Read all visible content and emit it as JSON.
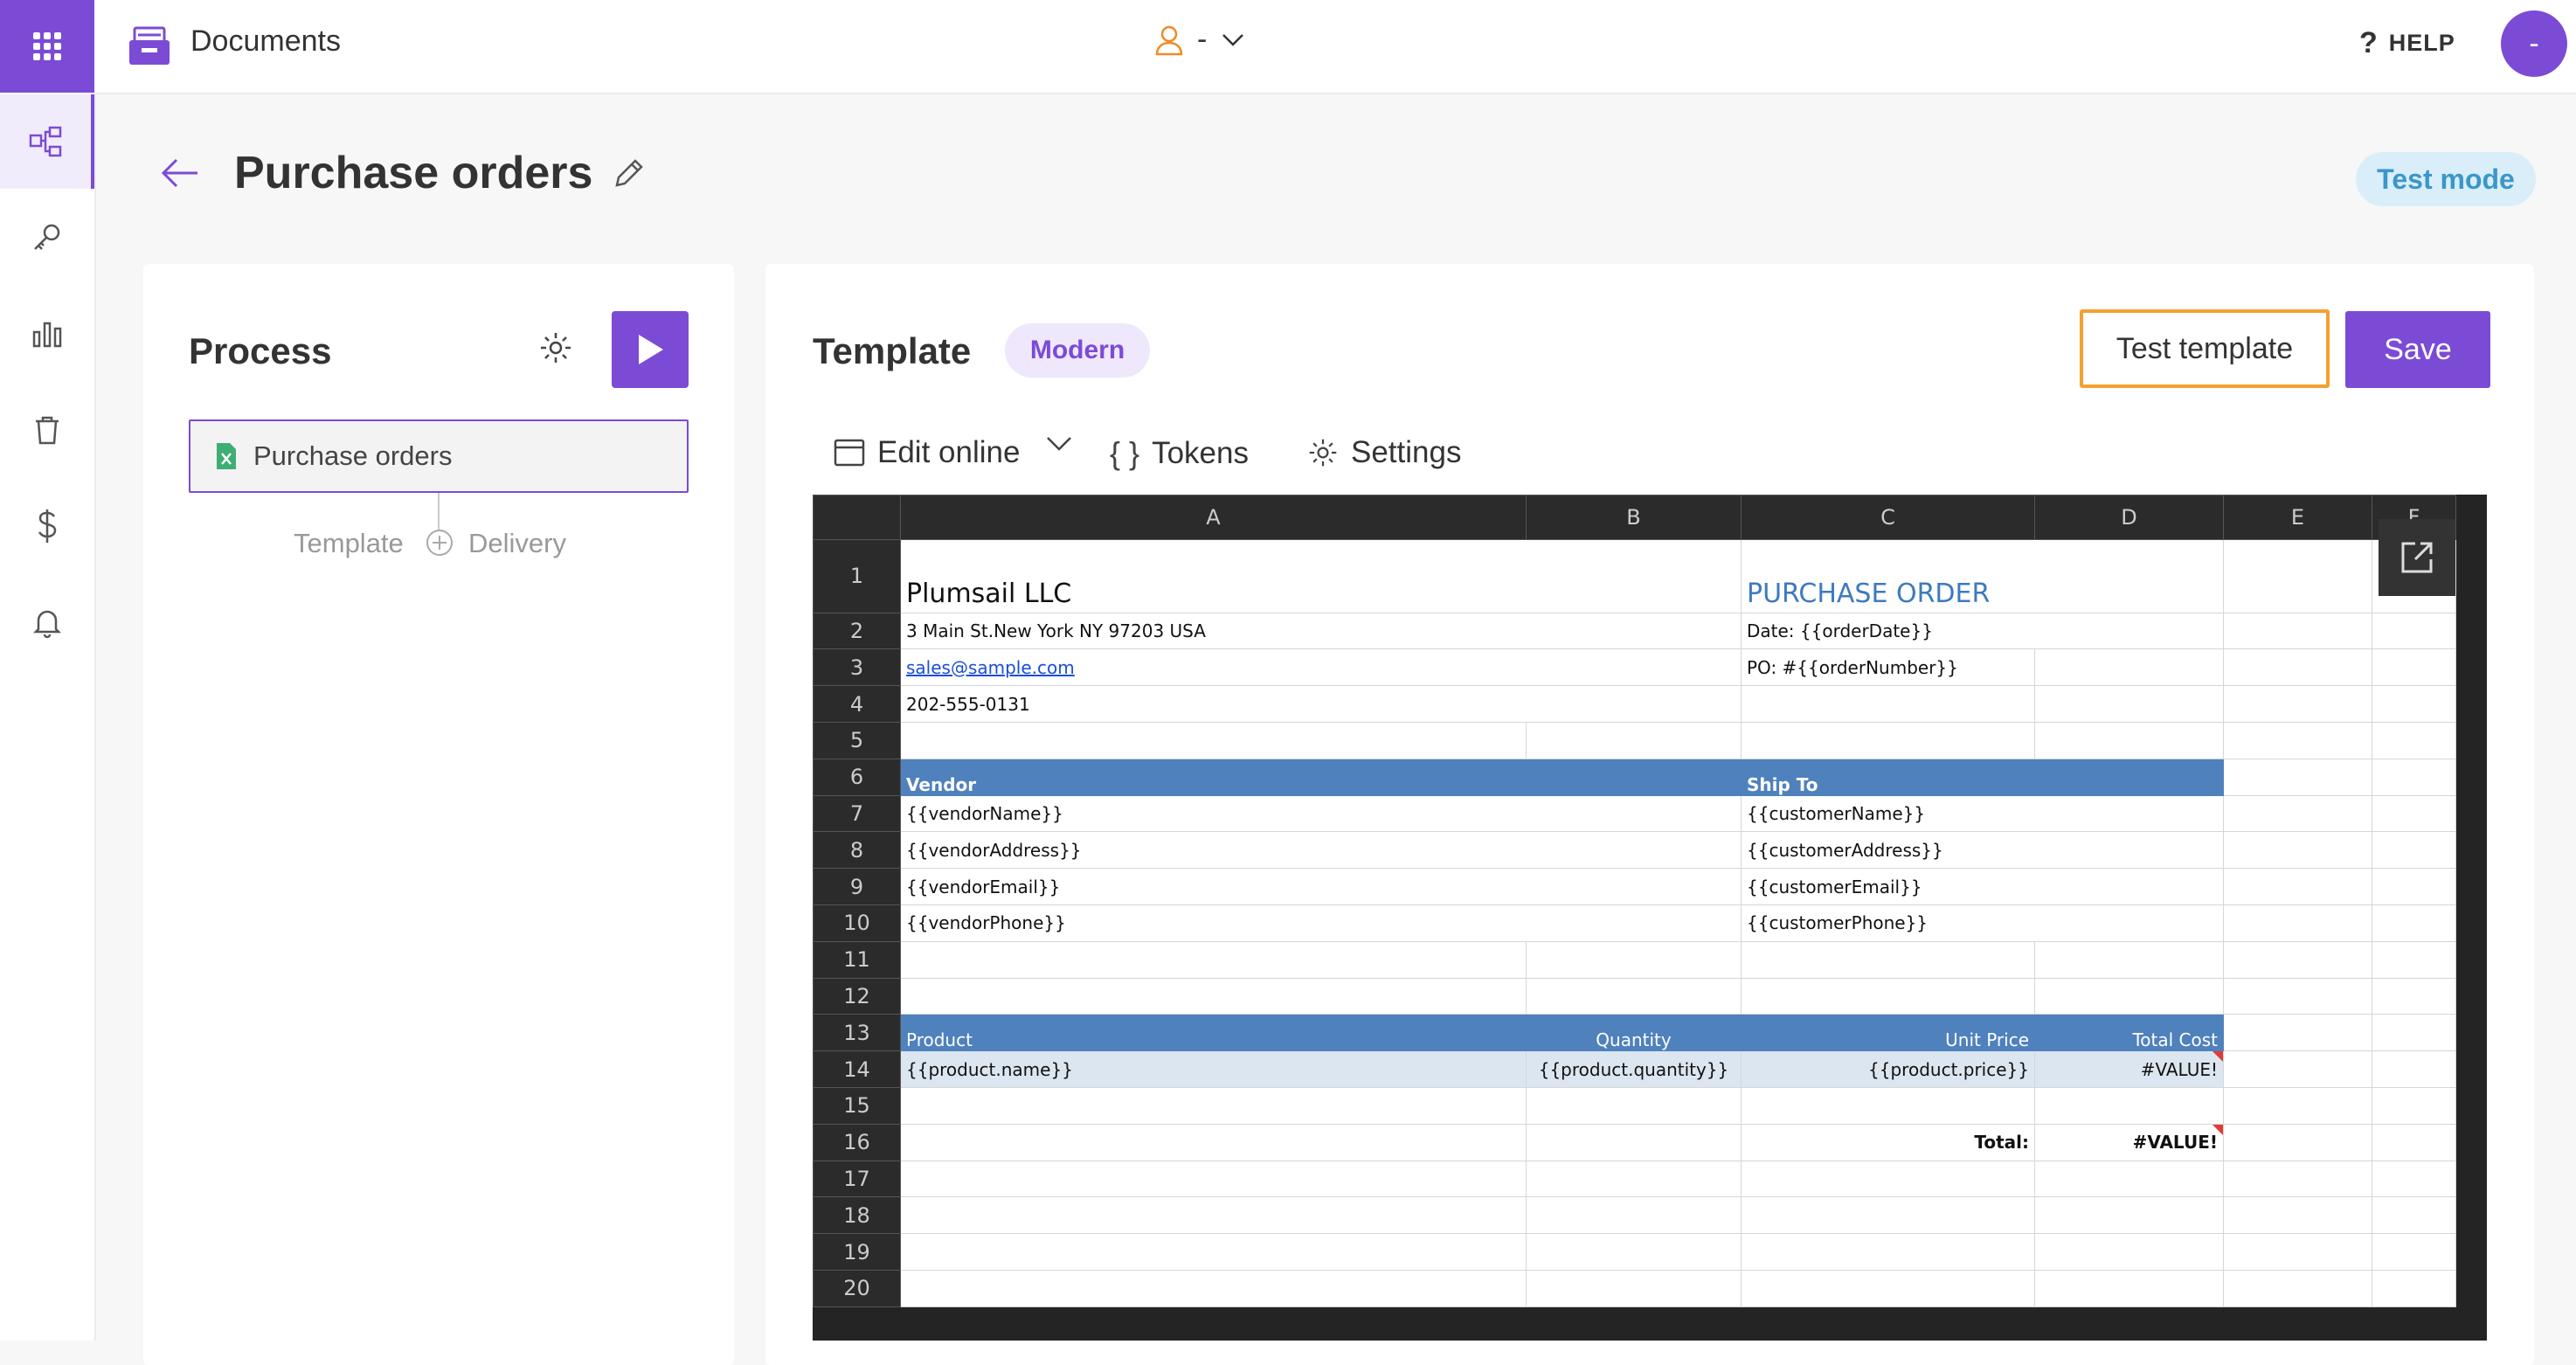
{
  "app": {
    "title": "Documents",
    "help_label": "HELP",
    "user_name": "-",
    "avatar_initial": "-"
  },
  "header": {
    "page_title": "Purchase orders",
    "mode_badge": "Test mode"
  },
  "process": {
    "title": "Process",
    "flow_item": "Purchase orders",
    "steps": [
      "Template",
      "Delivery"
    ]
  },
  "template": {
    "title": "Template",
    "badge": "Modern",
    "test_button": "Test template",
    "save_button": "Save",
    "toolbar": {
      "edit_online": "Edit online",
      "tokens": "Tokens",
      "settings": "Settings"
    }
  },
  "sheet": {
    "columns": [
      "A",
      "B",
      "C",
      "D",
      "E",
      "F"
    ],
    "rows": [
      "1",
      "2",
      "3",
      "4",
      "5",
      "6",
      "7",
      "8",
      "9",
      "10",
      "11",
      "12",
      "13",
      "14",
      "15",
      "16",
      "17",
      "18",
      "19",
      "20"
    ],
    "company": "Plumsail LLC",
    "doc_title": "PURCHASE ORDER",
    "address": "3 Main St.New York NY 97203 USA",
    "date": "Date: {{orderDate}}",
    "email": "sales@sample.com",
    "po": "PO: #{{orderNumber}}",
    "phone": "202-555-0131",
    "vendor_header": "Vendor",
    "ship_header": "Ship To",
    "vendor_name": "{{vendorName}}",
    "vendor_address": "{{vendorAddress}}",
    "vendor_email": "{{vendorEmail}}",
    "vendor_phone": "{{vendorPhone}}",
    "customer_name": "{{customerName}}",
    "customer_address": "{{customerAddress}}",
    "customer_email": "{{customerEmail}}",
    "customer_phone": "{{customerPhone}}",
    "col_product": "Product",
    "col_quantity": "Quantity",
    "col_unit_price": "Unit Price",
    "col_total_cost": "Total Cost",
    "product_name": "{{product.name}}",
    "product_quantity": "{{product.quantity}}",
    "product_price": "{{product.price}}",
    "value_error": "#VALUE!",
    "total_label": "Total:",
    "total_value": "#VALUE!"
  },
  "colors": {
    "accent": "#7b4bd6",
    "highlight": "#f5a030",
    "table_header": "#4f81bd"
  }
}
